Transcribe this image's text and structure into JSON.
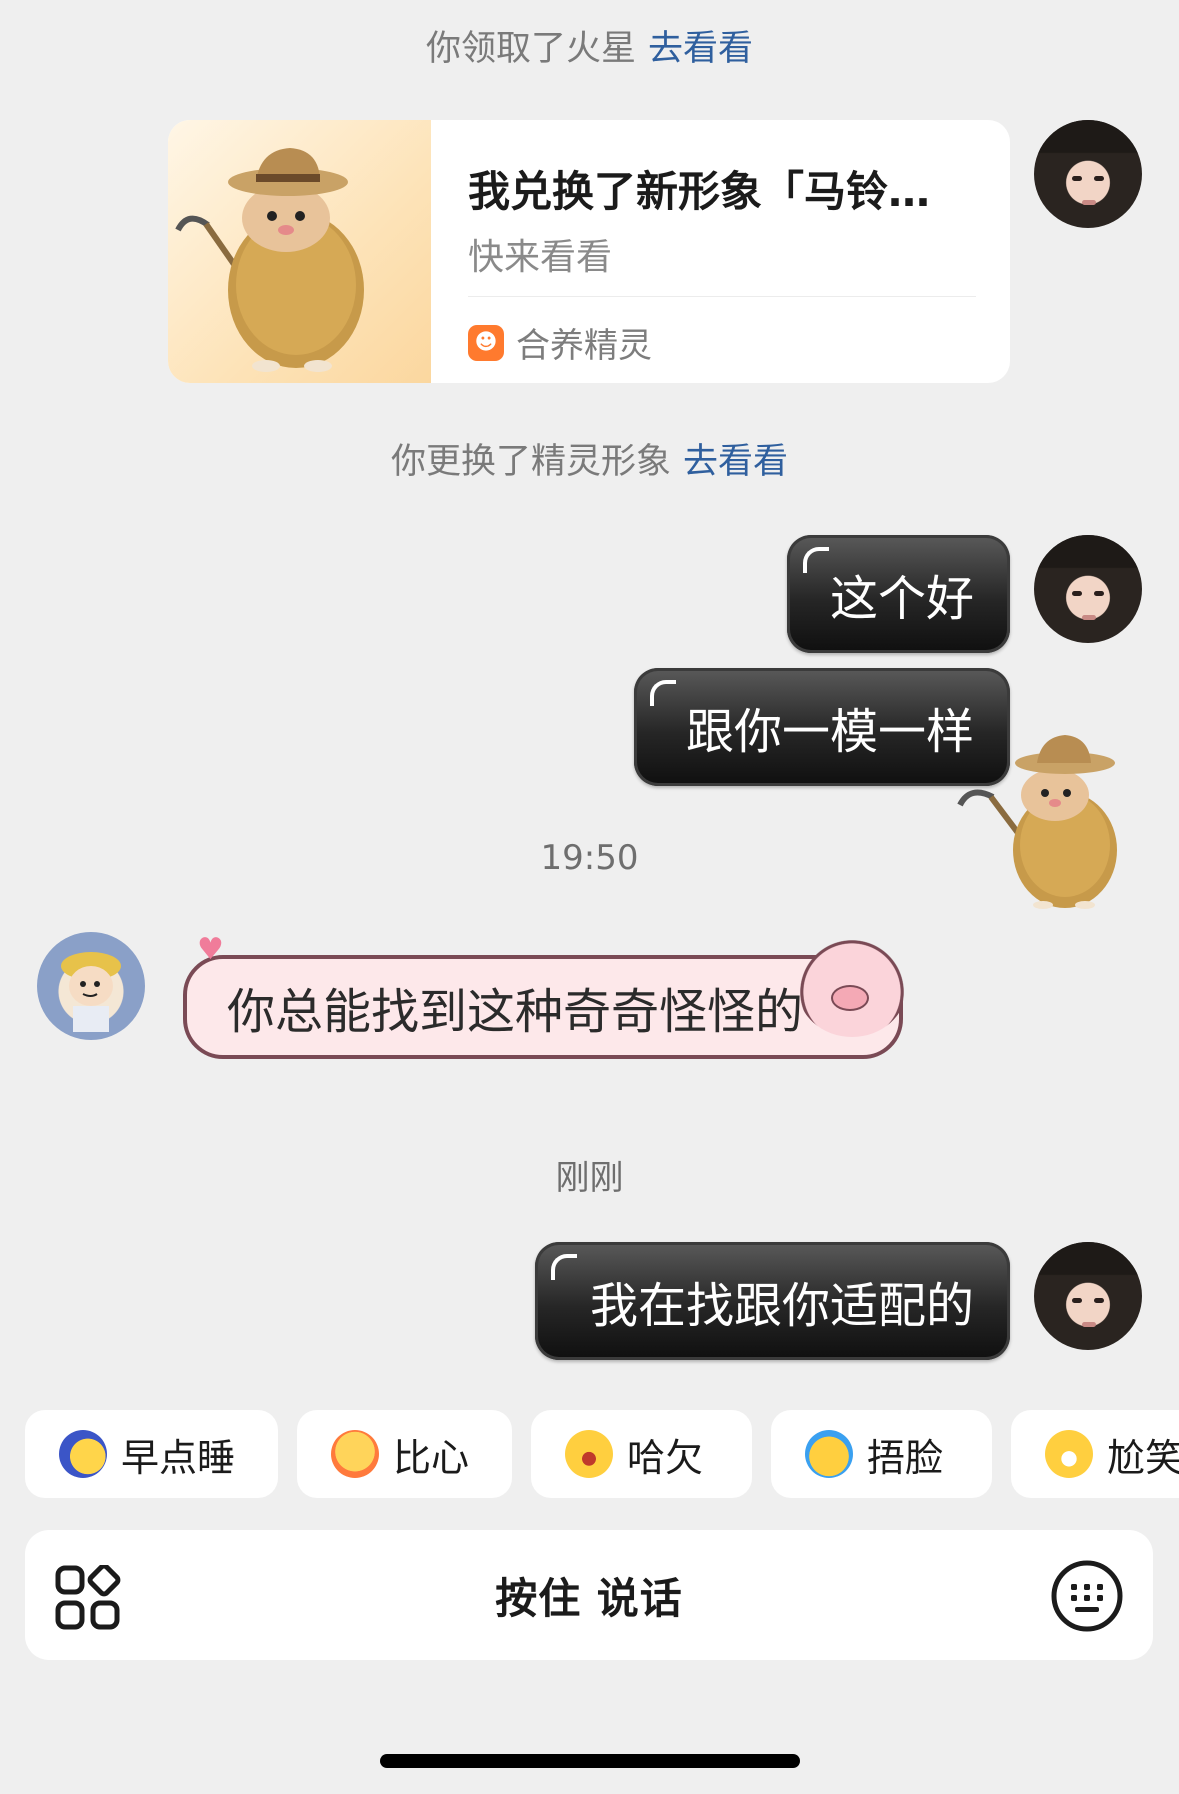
{
  "system_notices": [
    {
      "text": "你领取了火星",
      "link": "去看看"
    },
    {
      "text": "你更换了精灵形象",
      "link": "去看看"
    }
  ],
  "share_card": {
    "title": "我兑换了新形象「马铃…",
    "subtitle": "快来看看",
    "app_name": "合养精灵"
  },
  "messages": [
    {
      "side": "right",
      "text": "这个好"
    },
    {
      "side": "right",
      "text": "跟你一模一样"
    },
    {
      "side": "left",
      "text": "你总能找到这种奇奇怪怪的"
    },
    {
      "side": "right",
      "text": "我在找跟你适配的"
    }
  ],
  "timestamps": [
    "19:50",
    "刚刚"
  ],
  "quick_replies": [
    {
      "label": "早点睡",
      "icon": "sleepy-moon-emoji"
    },
    {
      "label": "比心",
      "icon": "heart-hands-emoji"
    },
    {
      "label": "哈欠",
      "icon": "yawn-emoji"
    },
    {
      "label": "捂脸",
      "icon": "facepalm-emoji"
    },
    {
      "label": "尬笑",
      "icon": "awkward-smile-emoji"
    }
  ],
  "input_bar": {
    "hold_to_talk": "按住 说话",
    "left_icon": "apps-grid-icon",
    "right_icon": "keyboard-icon"
  },
  "colors": {
    "background": "#efefef",
    "link": "#2f5f9e",
    "bubble_dark": "#1a1a1a",
    "pig_bubble": "#fde8ea",
    "app_icon": "#ff7a2e"
  }
}
